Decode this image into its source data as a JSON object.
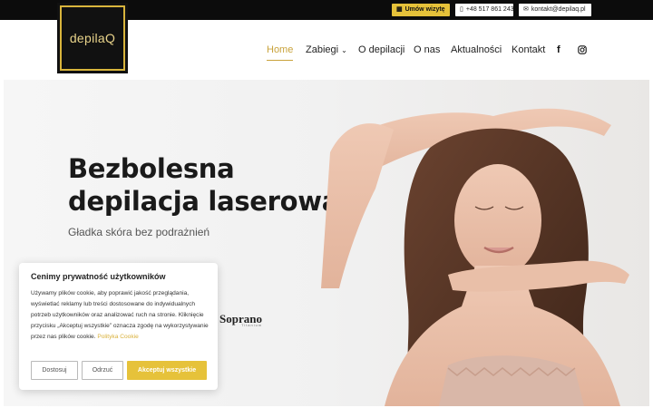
{
  "topbar": {
    "book_label": "Umów wizytę",
    "phone": "+48 517 861 243",
    "email": "kontakt@depilaq.pl"
  },
  "logo": {
    "text": "depilaQ"
  },
  "nav": {
    "home": "Home",
    "zabiegi": "Zabiegi",
    "o_depilacji": "O depilacji",
    "o_nas": "O nas",
    "aktualnosci": "Aktualności",
    "kontakt": "Kontakt"
  },
  "hero": {
    "title_line1": "Bezbolesna",
    "title_line2": "depilacja laserowa",
    "subtitle": "Gładka skóra bez podrażnień",
    "brand": "Soprano",
    "brand_sub": "Titanium"
  },
  "cookie": {
    "title": "Cenimy prywatność użytkowników",
    "text": "Używamy plików cookie, aby poprawić jakość przeglądania, wyświetlać reklamy lub treści dostosowane do indywidualnych potrzeb użytkowników oraz analizować ruch na stronie. Kliknięcie przycisku „Akceptuj wszystkie” oznacza zgodę na wykorzystywanie przez nas plików cookie.",
    "policy_link": "Polityka Cookie",
    "customize_label": "Dostosuj",
    "reject_label": "Odrzuć",
    "accept_label": "Akceptuj wszystkie"
  },
  "colors": {
    "accent": "#e6c23a",
    "dark": "#0c0c0c"
  }
}
